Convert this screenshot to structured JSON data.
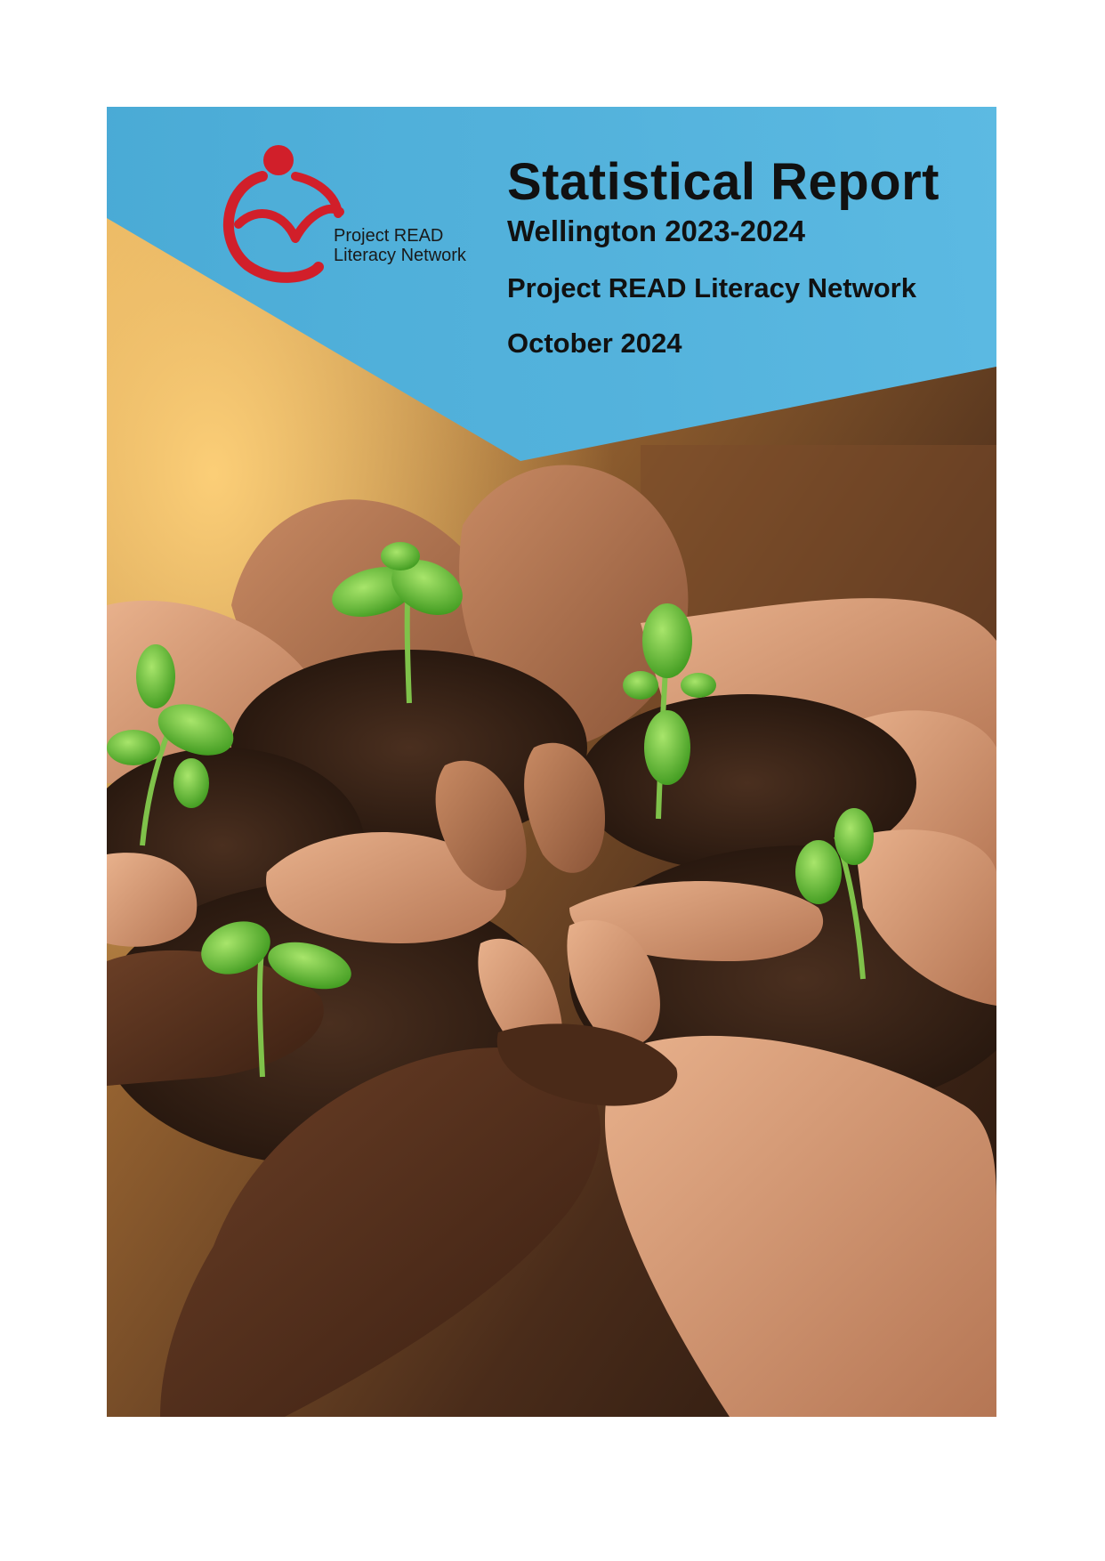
{
  "logo": {
    "line1": "Project READ",
    "line2": "Literacy Network",
    "color": "#d11f2a"
  },
  "header": {
    "title": "Statistical Report",
    "subtitle": "Wellington 2023-2024",
    "organization": "Project READ Literacy Network",
    "date": "October 2024"
  },
  "colors": {
    "banner": "#4fb3e3",
    "soil": "#3a2418",
    "sprout": "#6cc43a"
  }
}
